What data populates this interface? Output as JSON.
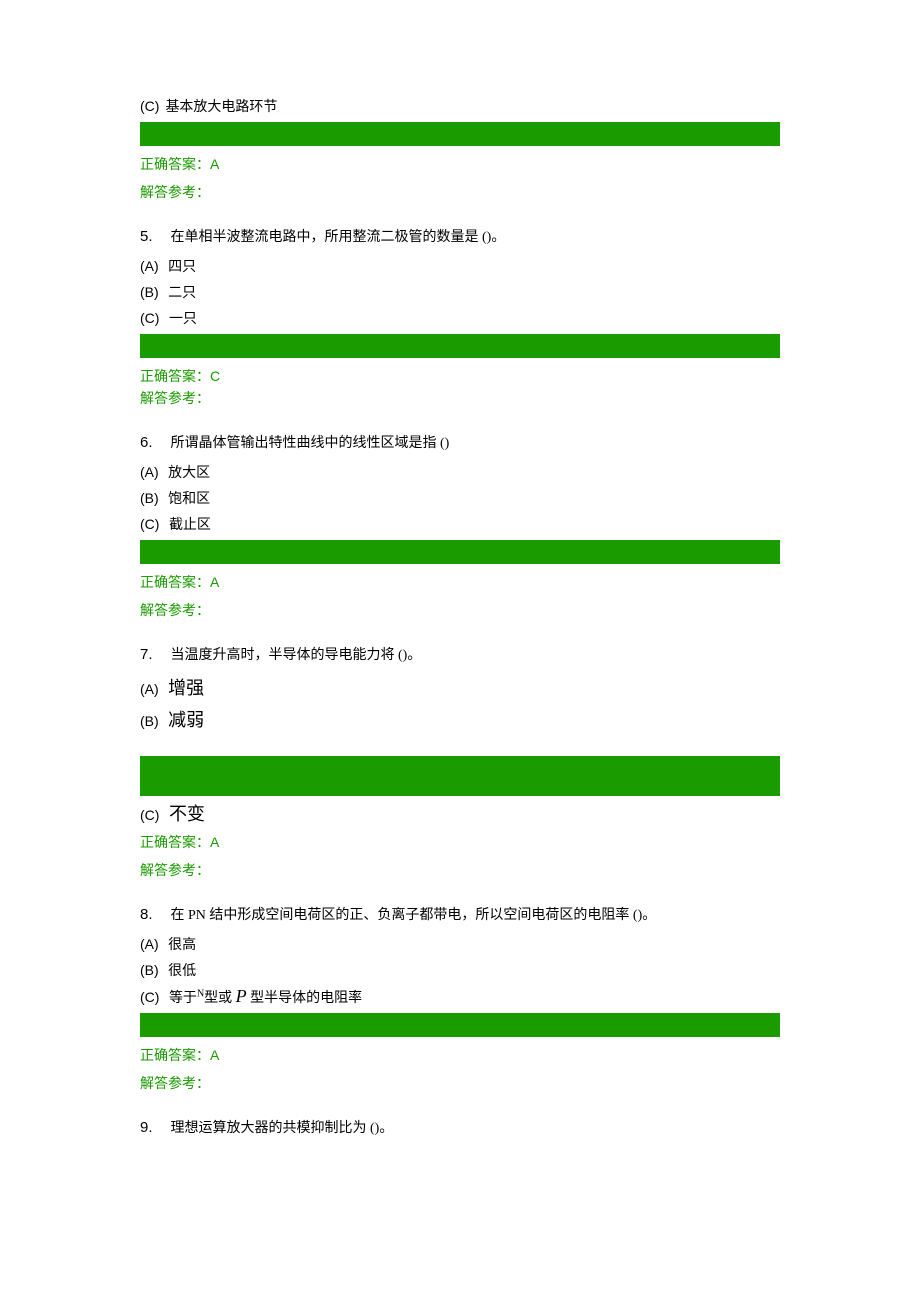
{
  "q4": {
    "optC_label": "(C)",
    "optC_text": "基本放大电路环节",
    "answer_label": "正确答案：",
    "answer_value": "A",
    "explain": "解答参考："
  },
  "q5": {
    "num": "5.",
    "text": "在单相半波整流电路中，所用整流二极管的数量是 ()。",
    "optA_label": "(A)",
    "optA_text": "四只",
    "optB_label": "(B)",
    "optB_text": "二只",
    "optC_label": "(C)",
    "optC_text": "一只",
    "answer_label": "正确答案：",
    "answer_value": "C",
    "explain": "解答参考："
  },
  "q6": {
    "num": "6.",
    "text": "所谓晶体管输出特性曲线中的线性区域是指 ()",
    "optA_label": "(A)",
    "optA_text": "放大区",
    "optB_label": "(B)",
    "optB_text": "饱和区",
    "optC_label": "(C)",
    "optC_text": "截止区",
    "answer_label": "正确答案：",
    "answer_value": "A",
    "explain": "解答参考："
  },
  "q7": {
    "num": "7.",
    "text": "当温度升高时，半导体的导电能力将 ()。",
    "optA_label": "(A)",
    "optA_text": "增强",
    "optB_label": "(B)",
    "optB_text": "减弱",
    "optC_label": "(C)",
    "optC_text": "不变",
    "answer_label": "正确答案：",
    "answer_value": "A",
    "explain": "解答参考："
  },
  "q8": {
    "num": "8.",
    "text": "在 PN 结中形成空间电荷区的正、负离子都带电，所以空间电荷区的电阻率 ()。",
    "optA_label": "(A)",
    "optA_text": "很高",
    "optB_label": "(B)",
    "optB_text": "很低",
    "optC_label": "(C)",
    "optC_prefix": "等于",
    "optC_sup": "N",
    "optC_mid1": "型或 ",
    "optC_p": "P",
    "optC_mid2": " 型半导体的电阻率",
    "answer_label": "正确答案：",
    "answer_value": "A",
    "explain": "解答参考："
  },
  "q9": {
    "num": "9.",
    "text": "理想运算放大器的共模抑制比为 ()。"
  }
}
